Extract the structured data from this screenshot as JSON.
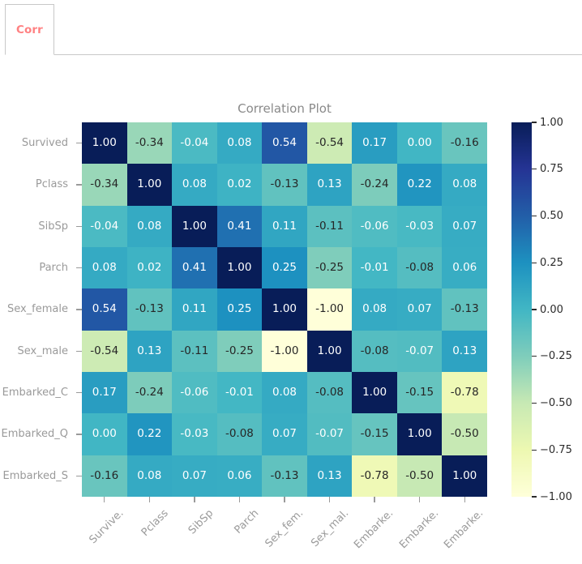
{
  "tabs": [
    {
      "label": "Corr",
      "active": true,
      "color": "#ff8182"
    }
  ],
  "chart_data": {
    "type": "heatmap",
    "title": "Correlation Plot",
    "xlabel": "",
    "ylabel": "",
    "colormap": "YlGnBu",
    "grid": false,
    "legend_position": "right",
    "colorbar": {
      "vmin": -1.0,
      "vmax": 1.0,
      "ticks": [
        1.0,
        0.75,
        0.5,
        0.25,
        0.0,
        -0.25,
        -0.5,
        -0.75,
        -1.0
      ],
      "tick_labels": [
        "1.00",
        "0.75",
        "0.50",
        "0.25",
        "0.00",
        "−0.25",
        "−0.50",
        "−0.75",
        "−1.00"
      ]
    },
    "y_tick_labels": [
      "Survived",
      "Pclass",
      "SibSp",
      "Parch",
      "Sex_female",
      "Sex_male",
      "Embarked_C",
      "Embarked_Q",
      "Embarked_S"
    ],
    "x_tick_labels": [
      "Survive.",
      "Pclass",
      "SibSp",
      "Parch",
      "Sex_fem.",
      "Sex_mal.",
      "Embarke.",
      "Embarke.",
      "Embarke."
    ],
    "rows": [
      "Survived",
      "Pclass",
      "SibSp",
      "Parch",
      "Sex_female",
      "Sex_male",
      "Embarked_C",
      "Embarked_Q",
      "Embarked_S"
    ],
    "columns": [
      "Survived",
      "Pclass",
      "SibSp",
      "Parch",
      "Sex_female",
      "Sex_male",
      "Embarked_C",
      "Embarked_Q",
      "Embarked_S"
    ],
    "values": [
      [
        1.0,
        -0.34,
        -0.04,
        0.08,
        0.54,
        -0.54,
        0.17,
        0.0,
        -0.16
      ],
      [
        -0.34,
        1.0,
        0.08,
        0.02,
        -0.13,
        0.13,
        -0.24,
        0.22,
        0.08
      ],
      [
        -0.04,
        0.08,
        1.0,
        0.41,
        0.11,
        -0.11,
        -0.06,
        -0.03,
        0.07
      ],
      [
        0.08,
        0.02,
        0.41,
        1.0,
        0.25,
        -0.25,
        -0.01,
        -0.08,
        0.06
      ],
      [
        0.54,
        -0.13,
        0.11,
        0.25,
        1.0,
        -1.0,
        0.08,
        0.07,
        -0.13
      ],
      [
        -0.54,
        0.13,
        -0.11,
        -0.25,
        -1.0,
        1.0,
        -0.08,
        -0.07,
        0.13
      ],
      [
        0.17,
        -0.24,
        -0.06,
        -0.01,
        0.08,
        -0.08,
        1.0,
        -0.15,
        -0.78
      ],
      [
        0.0,
        0.22,
        -0.03,
        -0.08,
        0.07,
        -0.07,
        -0.15,
        1.0,
        -0.5
      ],
      [
        -0.16,
        0.08,
        0.07,
        0.06,
        -0.13,
        0.13,
        -0.78,
        -0.5,
        1.0
      ]
    ],
    "annotations": [
      [
        "1.00",
        "-0.34",
        "-0.04",
        "0.08",
        "0.54",
        "-0.54",
        "0.17",
        "0.00",
        "-0.16"
      ],
      [
        "-0.34",
        "1.00",
        "0.08",
        "0.02",
        "-0.13",
        "0.13",
        "-0.24",
        "0.22",
        "0.08"
      ],
      [
        "-0.04",
        "0.08",
        "1.00",
        "0.41",
        "0.11",
        "-0.11",
        "-0.06",
        "-0.03",
        "0.07"
      ],
      [
        "0.08",
        "0.02",
        "0.41",
        "1.00",
        "0.25",
        "-0.25",
        "-0.01",
        "-0.08",
        "0.06"
      ],
      [
        "0.54",
        "-0.13",
        "0.11",
        "0.25",
        "1.00",
        "-1.00",
        "0.08",
        "0.07",
        "-0.13"
      ],
      [
        "-0.54",
        "0.13",
        "-0.11",
        "-0.25",
        "-1.00",
        "1.00",
        "-0.08",
        "-0.07",
        "0.13"
      ],
      [
        "0.17",
        "-0.24",
        "-0.06",
        "-0.01",
        "0.08",
        "-0.08",
        "1.00",
        "-0.15",
        "-0.78"
      ],
      [
        "0.00",
        "0.22",
        "-0.03",
        "-0.08",
        "0.07",
        "-0.07",
        "-0.15",
        "1.00",
        "-0.50"
      ],
      [
        "-0.16",
        "0.08",
        "0.07",
        "0.06",
        "-0.13",
        "0.13",
        "-0.78",
        "-0.50",
        "1.00"
      ]
    ]
  }
}
